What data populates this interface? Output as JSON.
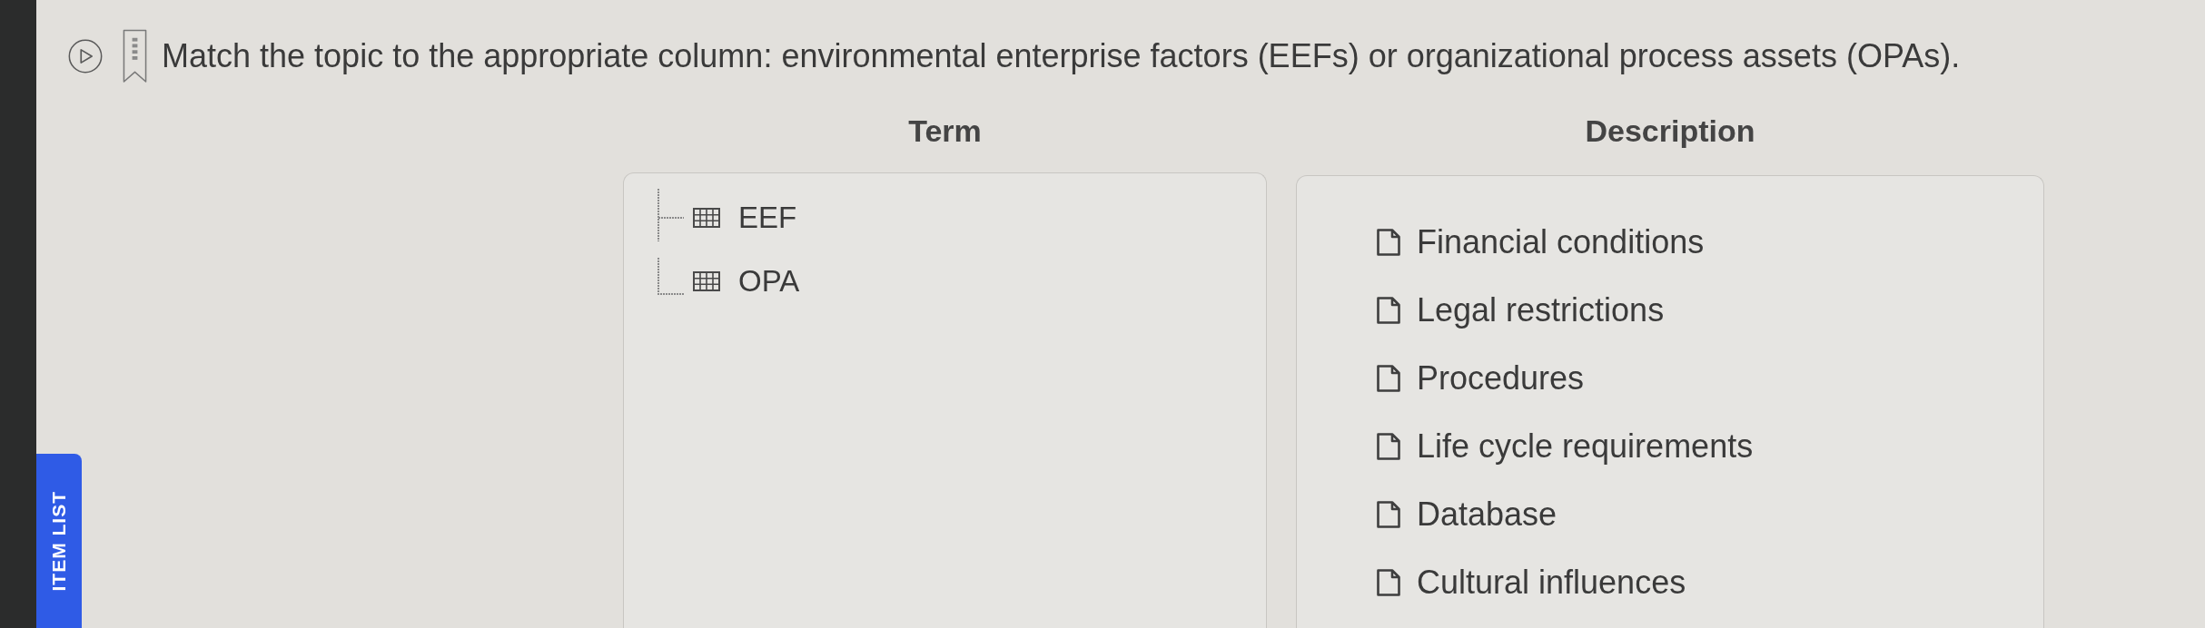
{
  "side_tab": {
    "label": "ITEM LIST"
  },
  "question": {
    "text": "Match the topic to the appropriate column: environmental enterprise factors (EEFs) or organizational process assets (OPAs)."
  },
  "term_column": {
    "heading": "Term",
    "tree": [
      {
        "label": "EEF"
      },
      {
        "label": "OPA"
      }
    ]
  },
  "description_column": {
    "heading": "Description",
    "items": [
      {
        "label": "Financial conditions"
      },
      {
        "label": "Legal restrictions"
      },
      {
        "label": "Procedures"
      },
      {
        "label": "Life cycle requirements"
      },
      {
        "label": "Database"
      },
      {
        "label": "Cultural influences"
      }
    ]
  }
}
